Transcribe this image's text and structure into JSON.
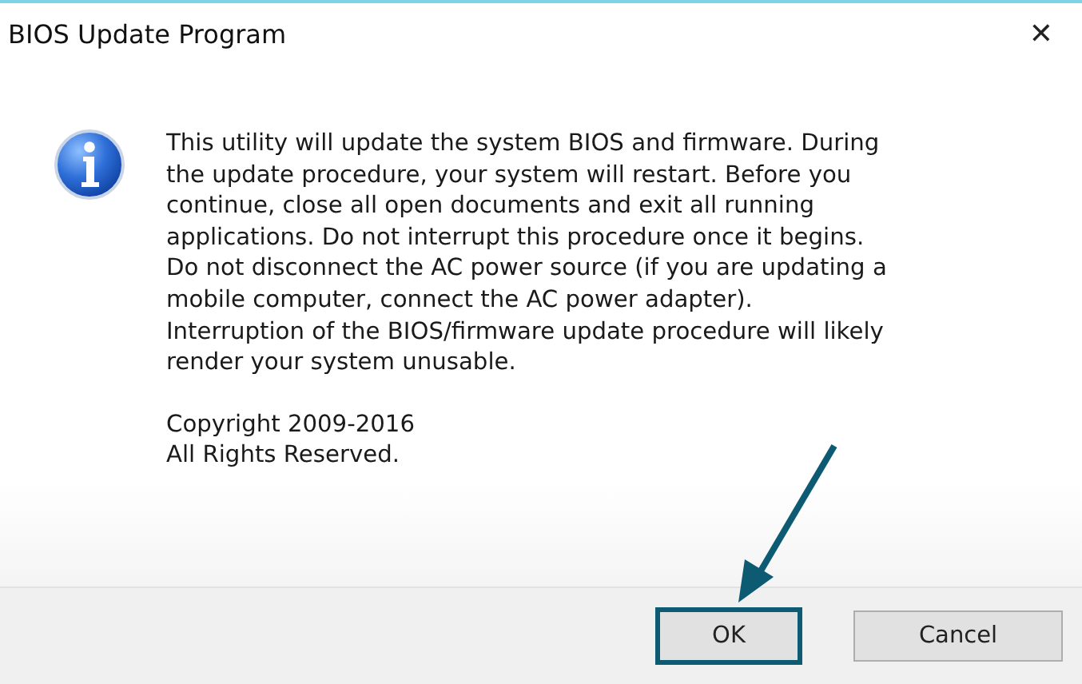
{
  "window": {
    "title": "BIOS Update Program",
    "close": "✕"
  },
  "message": "This utility will update the system BIOS and firmware.  During\nthe update procedure, your system will restart.  Before you\ncontinue, close all open documents and exit all running\napplications.  Do not interrupt this procedure once it begins.\nDo not disconnect the AC power source (if you are updating a\nmobile computer, connect the AC power adapter).\nInterruption of the BIOS/firmware update procedure will likely\nrender your system unusable.",
  "copyright": "Copyright 2009-2016\nAll Rights Reserved.",
  "buttons": [
    {
      "label": "OK",
      "highlighted": true
    },
    {
      "label": "Cancel",
      "highlighted": false
    }
  ]
}
